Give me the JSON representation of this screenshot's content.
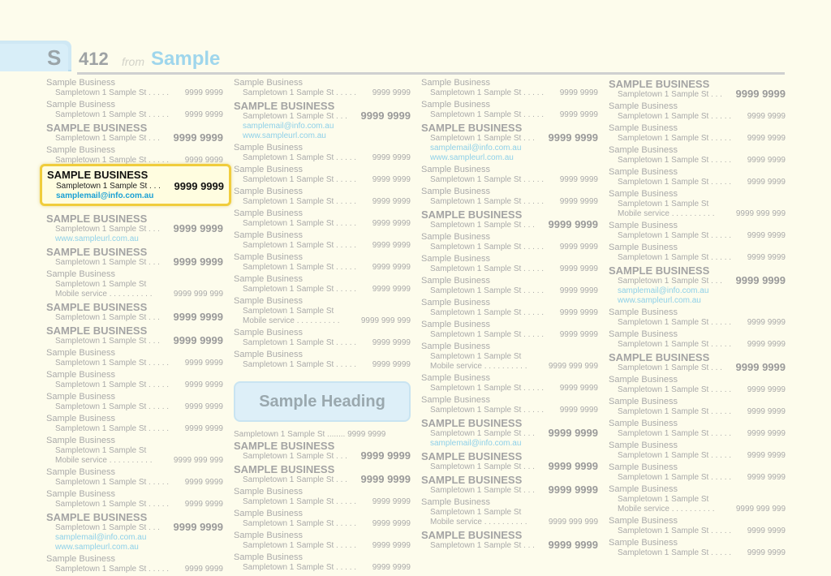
{
  "header": {
    "letter": "S",
    "page_number": "412",
    "from_label": "from",
    "section": "Sample"
  },
  "heading": "Sample Heading",
  "highlight": {
    "name": "SAMPLE BUSINESS",
    "address": "Sampletown  1 Sample St . . .",
    "phone": "9999 9999",
    "email": "samplemail@info.com.au"
  },
  "columns": [
    [
      {
        "name": "Sample Business",
        "addr": "Sampletown  1 Sample St . . . . .",
        "phone": "9999 9999"
      },
      {
        "name": "Sample Business",
        "addr": "Sampletown  1 Sample St . . . . .",
        "phone": "9999 9999"
      },
      {
        "name": "SAMPLE BUSINESS",
        "big": true,
        "addr": "Sampletown  1 Sample St . . .",
        "phone": "9999 9999"
      },
      {
        "name": "Sample Business",
        "addr": "Sampletown  1 Sample St . . . . .",
        "phone": "9999 9999"
      },
      {
        "spacer": true
      },
      {
        "name": "SAMPLE BUSINESS",
        "big": true,
        "addr": "Sampletown  1 Sample St . . .",
        "phone": "9999 9999",
        "web": "www.sampleurl.com.au"
      },
      {
        "name": "SAMPLE BUSINESS",
        "big": true,
        "addr": "Sampletown  1 Sample St . . .",
        "phone": "9999 9999"
      },
      {
        "name": "Sample Business",
        "addr": "Sampletown  1 Sample St",
        "mobile": "Mobile service . . . . . . . . . .",
        "phone2": "9999 999 999"
      },
      {
        "name": "SAMPLE BUSINESS",
        "big": true,
        "addr": "Sampletown  1 Sample St . . .",
        "phone": "9999 9999"
      },
      {
        "name": "SAMPLE BUSINESS",
        "big": true,
        "addr": "Sampletown  1 Sample St . . .",
        "phone": "9999 9999"
      },
      {
        "name": "Sample Business",
        "addr": "Sampletown  1 Sample St . . . . .",
        "phone": "9999 9999"
      },
      {
        "name": "Sample Business",
        "addr": "Sampletown  1 Sample St . . . . .",
        "phone": "9999 9999"
      },
      {
        "name": "Sample Business",
        "addr": "Sampletown  1 Sample St . . . . .",
        "phone": "9999 9999"
      },
      {
        "name": "Sample Business",
        "addr": "Sampletown  1 Sample St . . . . .",
        "phone": "9999 9999"
      },
      {
        "name": "Sample Business",
        "addr": "Sampletown  1 Sample St",
        "mobile": "Mobile service . . . . . . . . . .",
        "phone2": "9999 999 999"
      },
      {
        "name": "Sample Business",
        "addr": "Sampletown  1 Sample St . . . . .",
        "phone": "9999 9999"
      },
      {
        "name": "Sample Business",
        "addr": "Sampletown  1 Sample St . . . . .",
        "phone": "9999 9999"
      },
      {
        "name": "SAMPLE BUSINESS",
        "big": true,
        "addr": "Sampletown  1 Sample St . . .",
        "phone": "9999 9999",
        "email": "samplemail@info.com.au",
        "web": "www.sampleurl.com.au"
      },
      {
        "name": "Sample Business",
        "addr": "Sampletown  1 Sample St . . . . .",
        "phone": "9999 9999"
      }
    ],
    [
      {
        "name": "Sample Business",
        "addr": "Sampletown  1 Sample St . . . . .",
        "phone": "9999 9999"
      },
      {
        "name": "SAMPLE BUSINESS",
        "big": true,
        "addr": "Sampletown  1 Sample St . . .",
        "phone": "9999 9999",
        "email": "samplemail@info.com.au",
        "web": "www.sampleurl.com.au"
      },
      {
        "name": "Sample Business",
        "addr": "Sampletown  1 Sample St . . . . .",
        "phone": "9999 9999"
      },
      {
        "name": "Sample Business",
        "addr": "Sampletown  1 Sample St . . . . .",
        "phone": "9999 9999"
      },
      {
        "name": "Sample Business",
        "addr": "Sampletown  1 Sample St . . . . .",
        "phone": "9999 9999"
      },
      {
        "name": "Sample Business",
        "addr": "Sampletown  1 Sample St . . . . .",
        "phone": "9999 9999"
      },
      {
        "name": "Sample Business",
        "addr": "Sampletown  1 Sample St . . . . .",
        "phone": "9999 9999"
      },
      {
        "name": "Sample Business",
        "addr": "Sampletown  1 Sample St . . . . .",
        "phone": "9999 9999"
      },
      {
        "name": "Sample Business",
        "addr": "Sampletown  1 Sample St . . . . .",
        "phone": "9999 9999"
      },
      {
        "name": "Sample Business",
        "addr": "Sampletown  1 Sample St",
        "mobile": "Mobile service . . . . . . . . . .",
        "phone2": "9999 999 999"
      },
      {
        "name": "Sample Business",
        "addr": "Sampletown  1 Sample St . . . . .",
        "phone": "9999 9999"
      },
      {
        "name": "Sample Business",
        "addr": "Sampletown  1 Sample St . . . . .",
        "phone": "9999 9999"
      },
      {
        "heading": true
      },
      {
        "plain": "Sampletown  1 Sample St ........ 9999 9999"
      },
      {
        "name": "SAMPLE BUSINESS",
        "big": true,
        "addr": "Sampletown  1 Sample St . . .",
        "phone": "9999 9999"
      },
      {
        "name": "SAMPLE BUSINESS",
        "big": true,
        "addr": "Sampletown  1 Sample St . . .",
        "phone": "9999 9999"
      },
      {
        "name": "Sample Business",
        "addr": "Sampletown  1 Sample St . . . . .",
        "phone": "9999 9999"
      },
      {
        "name": "Sample Business",
        "addr": "Sampletown  1 Sample St . . . . .",
        "phone": "9999 9999"
      },
      {
        "name": "Sample Business",
        "addr": "Sampletown  1 Sample St . . . . .",
        "phone": "9999 9999"
      },
      {
        "name": "Sample Business",
        "addr": "Sampletown  1 Sample St . . . . .",
        "phone": "9999 9999"
      }
    ],
    [
      {
        "name": "Sample Business",
        "addr": "Sampletown  1 Sample St . . . . .",
        "phone": "9999 9999"
      },
      {
        "name": "Sample Business",
        "addr": "Sampletown  1 Sample St . . . . .",
        "phone": "9999 9999"
      },
      {
        "name": "SAMPLE BUSINESS",
        "big": true,
        "addr": "Sampletown  1 Sample St . . .",
        "phone": "9999 9999",
        "email": "samplemail@info.com.au",
        "web": "www.sampleurl.com.au"
      },
      {
        "name": "Sample Business",
        "addr": "Sampletown  1 Sample St . . . . .",
        "phone": "9999 9999"
      },
      {
        "name": "Sample Business",
        "addr": "Sampletown  1 Sample St . . . . .",
        "phone": "9999 9999"
      },
      {
        "name": "SAMPLE BUSINESS",
        "big": true,
        "addr": "Sampletown  1 Sample St . . .",
        "phone": "9999 9999"
      },
      {
        "name": "Sample Business",
        "addr": "Sampletown  1 Sample St . . . . .",
        "phone": "9999 9999"
      },
      {
        "name": "Sample Business",
        "addr": "Sampletown  1 Sample St . . . . .",
        "phone": "9999 9999"
      },
      {
        "name": "Sample Business",
        "addr": "Sampletown  1 Sample St . . . . .",
        "phone": "9999 9999"
      },
      {
        "name": "Sample Business",
        "addr": "Sampletown  1 Sample St . . . . .",
        "phone": "9999 9999"
      },
      {
        "name": "Sample Business",
        "addr": "Sampletown  1 Sample St . . . . .",
        "phone": "9999 9999"
      },
      {
        "name": "Sample Business",
        "addr": "Sampletown  1 Sample St",
        "mobile": "Mobile service . . . . . . . . . .",
        "phone2": "9999 999 999"
      },
      {
        "name": "Sample Business",
        "addr": "Sampletown  1 Sample St . . . . .",
        "phone": "9999 9999"
      },
      {
        "name": "Sample Business",
        "addr": "Sampletown  1 Sample St . . . . .",
        "phone": "9999 9999"
      },
      {
        "name": "SAMPLE BUSINESS",
        "big": true,
        "addr": "Sampletown  1 Sample St . . .",
        "phone": "9999 9999",
        "email": "samplemail@info.com.au"
      },
      {
        "name": "SAMPLE BUSINESS",
        "big": true,
        "addr": "Sampletown  1 Sample St . . .",
        "phone": "9999 9999"
      },
      {
        "name": "SAMPLE BUSINESS",
        "big": true,
        "addr": "Sampletown  1 Sample St . . .",
        "phone": "9999 9999"
      },
      {
        "name": "Sample Business",
        "addr": "Sampletown  1 Sample St",
        "mobile": "Mobile service . . . . . . . . . .",
        "phone2": "9999 999 999"
      },
      {
        "name": "SAMPLE BUSINESS",
        "big": true,
        "addr": "Sampletown  1 Sample St . . .",
        "phone": "9999 9999"
      }
    ],
    [
      {
        "name": "SAMPLE BUSINESS",
        "big": true,
        "addr": "Sampletown  1 Sample St . . .",
        "phone": "9999 9999"
      },
      {
        "name": "Sample Business",
        "addr": "Sampletown  1 Sample St . . . . .",
        "phone": "9999 9999"
      },
      {
        "name": "Sample Business",
        "addr": "Sampletown  1 Sample St . . . . .",
        "phone": "9999 9999"
      },
      {
        "name": "Sample Business",
        "addr": "Sampletown  1 Sample St . . . . .",
        "phone": "9999 9999"
      },
      {
        "name": "Sample Business",
        "addr": "Sampletown  1 Sample St . . . . .",
        "phone": "9999 9999"
      },
      {
        "name": "Sample Business",
        "addr": "Sampletown  1 Sample St",
        "mobile": "Mobile service . . . . . . . . . .",
        "phone2": "9999 999 999"
      },
      {
        "name": "Sample Business",
        "addr": "Sampletown  1 Sample St . . . . .",
        "phone": "9999 9999"
      },
      {
        "name": "Sample Business",
        "addr": "Sampletown  1 Sample St . . . . .",
        "phone": "9999 9999"
      },
      {
        "name": "SAMPLE BUSINESS",
        "big": true,
        "addr": "Sampletown  1 Sample St . . .",
        "phone": "9999 9999",
        "email": "samplemail@info.com.au",
        "web": "www.sampleurl.com.au"
      },
      {
        "name": "Sample Business",
        "addr": "Sampletown  1 Sample St . . . . .",
        "phone": "9999 9999"
      },
      {
        "name": "Sample Business",
        "addr": "Sampletown  1 Sample St . . . . .",
        "phone": "9999 9999"
      },
      {
        "name": "SAMPLE BUSINESS",
        "big": true,
        "addr": "Sampletown  1 Sample St . . .",
        "phone": "9999 9999"
      },
      {
        "name": "Sample Business",
        "addr": "Sampletown  1 Sample St . . . . .",
        "phone": "9999 9999"
      },
      {
        "name": "Sample Business",
        "addr": "Sampletown  1 Sample St . . . . .",
        "phone": "9999 9999"
      },
      {
        "name": "Sample Business",
        "addr": "Sampletown  1 Sample St . . . . .",
        "phone": "9999 9999"
      },
      {
        "name": "Sample Business",
        "addr": "Sampletown  1 Sample St . . . . .",
        "phone": "9999 9999"
      },
      {
        "name": "Sample Business",
        "addr": "Sampletown  1 Sample St . . . . .",
        "phone": "9999 9999"
      },
      {
        "name": "Sample Business",
        "addr": "Sampletown  1 Sample St",
        "mobile": "Mobile service . . . . . . . . . .",
        "phone2": "9999 999 999"
      },
      {
        "name": "Sample Business",
        "addr": "Sampletown  1 Sample St . . . . .",
        "phone": "9999 9999"
      },
      {
        "name": "Sample Business",
        "addr": "Sampletown  1 Sample St . . . . .",
        "phone": "9999 9999"
      }
    ]
  ]
}
